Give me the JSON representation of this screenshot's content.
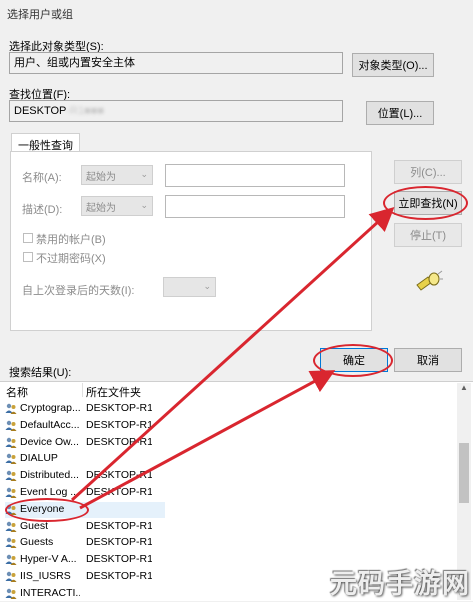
{
  "window": {
    "title": "选择用户或组"
  },
  "object_type": {
    "label": "选择此对象类型(S):",
    "value": "用户、组或内置安全主体",
    "button": "对象类型(O)..."
  },
  "location": {
    "label": "查找位置(F):",
    "value": "DESKTOP",
    "button": "位置(L)..."
  },
  "query": {
    "tab": "一般性查询",
    "name_label": "名称(A):",
    "name_combo": "起始为",
    "desc_label": "描述(D):",
    "desc_combo": "起始为",
    "disabled_accounts": "禁用的帐户(B)",
    "nonexpiring_pwd": "不过期密码(X)",
    "days_label": "自上次登录后的天数(I):"
  },
  "buttons": {
    "columns": "列(C)...",
    "find_now": "立即查找(N)",
    "stop": "停止(T)",
    "ok": "确定",
    "cancel": "取消"
  },
  "results": {
    "label": "搜索结果(U):",
    "col_name": "名称",
    "col_folder": "所在文件夹",
    "rows": [
      {
        "name": "Cryptograp...",
        "folder": "DESKTOP-R1..."
      },
      {
        "name": "DefaultAcc...",
        "folder": "DESKTOP-R1..."
      },
      {
        "name": "Device Ow...",
        "folder": "DESKTOP-R1..."
      },
      {
        "name": "DIALUP",
        "folder": ""
      },
      {
        "name": "Distributed...",
        "folder": "DESKTOP-R1..."
      },
      {
        "name": "Event Log ...",
        "folder": "DESKTOP-R1..."
      },
      {
        "name": "Everyone",
        "folder": ""
      },
      {
        "name": "Guest",
        "folder": "DESKTOP-R1..."
      },
      {
        "name": "Guests",
        "folder": "DESKTOP-R1..."
      },
      {
        "name": "Hyper-V A...",
        "folder": "DESKTOP-R1..."
      },
      {
        "name": "IIS_IUSRS",
        "folder": "DESKTOP-R1..."
      },
      {
        "name": "INTERACTI...",
        "folder": ""
      }
    ]
  },
  "watermark": "元码手游网",
  "colors": {
    "annotation": "#d9262f",
    "selected_row": "#e5f1fb"
  }
}
